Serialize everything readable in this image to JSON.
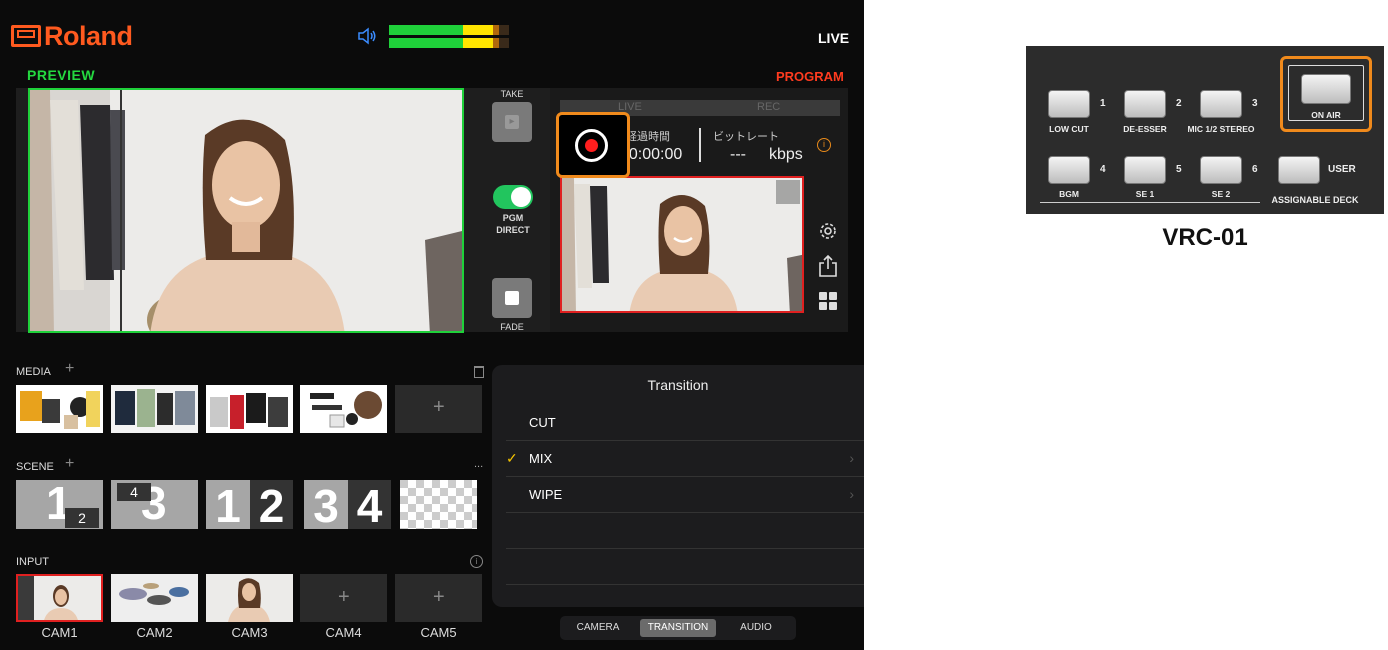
{
  "header": {
    "logo_text": "Roland",
    "live_label": "LIVE"
  },
  "preview": {
    "label": "PREVIEW"
  },
  "program": {
    "label": "PROGRAM",
    "status_live": "LIVE",
    "status_rec": "REC",
    "elapsed_label": "経過時間",
    "elapsed_value": "00:00:00",
    "bitrate_label": "ビットレート",
    "bitrate_value": "---",
    "bitrate_unit": "kbps"
  },
  "controls": {
    "take_label": "TAKE",
    "pgm_direct_line1": "PGM",
    "pgm_direct_line2": "DIRECT",
    "fade_label": "FADE"
  },
  "media": {
    "label": "MEDIA",
    "add_symbol": "+"
  },
  "scene": {
    "label": "SCENE",
    "more": "...",
    "items": [
      {
        "main": "1",
        "sub": "2"
      },
      {
        "main": "3",
        "sub": "4"
      },
      {
        "left": "1",
        "right": "2"
      },
      {
        "left": "3",
        "right": "4"
      }
    ]
  },
  "input": {
    "label": "INPUT",
    "items": [
      "CAM1",
      "CAM2",
      "CAM3",
      "CAM4",
      "CAM5"
    ]
  },
  "transition": {
    "title": "Transition",
    "items": [
      {
        "label": "CUT",
        "checked": false
      },
      {
        "label": "MIX",
        "checked": true
      },
      {
        "label": "WIPE",
        "checked": false
      }
    ],
    "check_mark": "✓",
    "chevron": "›"
  },
  "tabs": {
    "items": [
      "CAMERA",
      "TRANSITION",
      "AUDIO"
    ],
    "active": "TRANSITION"
  },
  "device": {
    "title": "VRC-01",
    "buttons": [
      {
        "num": "1",
        "label": "LOW CUT"
      },
      {
        "num": "2",
        "label": "DE-ESSER"
      },
      {
        "num": "3",
        "label": "MIC 1/2 STEREO"
      },
      {
        "num": "4",
        "label": "BGM"
      },
      {
        "num": "5",
        "label": "SE 1"
      },
      {
        "num": "6",
        "label": "SE 2"
      }
    ],
    "on_air_label": "ON AIR",
    "user_label": "USER",
    "assignable_label": "ASSIGNABLE DECK"
  },
  "colors": {
    "brand": "#ff5a1f",
    "preview_green": "#1fd13a",
    "program_red": "#e02020",
    "highlight_orange": "#f08a1c"
  }
}
